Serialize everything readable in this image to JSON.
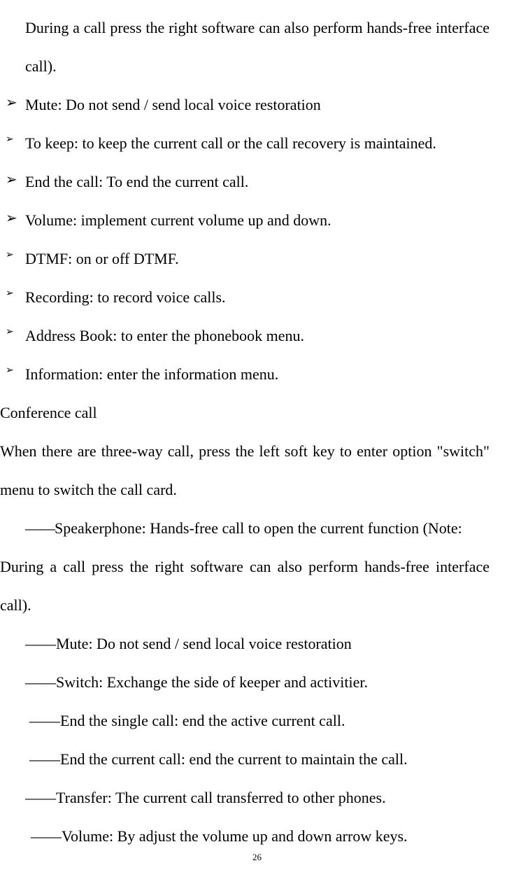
{
  "top_para": "During a call press the right software can also perform hands-free interface call).",
  "bullets": [
    {
      "size": "big",
      "text": "Mute: Do not send / send local voice restoration"
    },
    {
      "size": "small",
      "text": "To keep: to keep the current call or the call recovery is maintained."
    },
    {
      "size": "big",
      "text": "End the call: To end the current call."
    },
    {
      "size": "big",
      "text": "Volume: implement current volume up and down."
    },
    {
      "size": "small",
      "text": "DTMF: on or off DTMF."
    },
    {
      "size": "small",
      "text": "Recording: to record voice calls."
    },
    {
      "size": "small",
      "text": "Address Book: to enter the phonebook menu."
    },
    {
      "size": "small",
      "text": "Information: enter the information menu."
    }
  ],
  "heading": "Conference call",
  "para2": "When there are three-way call, press the left soft key to enter option \"switch\" menu to switch the call card.",
  "dash_items": [
    {
      "cls": "dash-line",
      "prefix": "――",
      "text": "Speakerphone: Hands-free call to open the current function (Note:"
    },
    {
      "cls": "cont-line",
      "prefix": "",
      "text": "During a call press the right software can also perform hands-free interface call)."
    },
    {
      "cls": "left-dash",
      "prefix": "――",
      "text": "Mute: Do not send / send local voice restoration"
    },
    {
      "cls": "left-dash",
      "prefix": "――",
      "text": "Switch: Exchange the side of keeper and activitier."
    },
    {
      "cls": "left-dash2",
      "prefix": "――",
      "text": "End the single call: end the active current call."
    },
    {
      "cls": "left-dash2",
      "prefix": "――",
      "text": "End the current call: end the current to maintain the call."
    },
    {
      "cls": "left-dash",
      "prefix": "――",
      "text": "Transfer: The current call transferred to other phones."
    },
    {
      "cls": "left-dash3",
      "prefix": "――",
      "text": "Volume: By adjust the volume up and down arrow keys."
    }
  ],
  "page_number": "26"
}
